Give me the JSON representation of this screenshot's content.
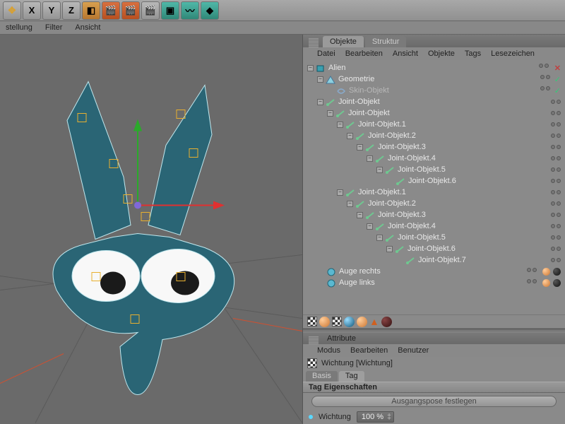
{
  "toolbar": {
    "axis_buttons": [
      "X",
      "Y",
      "Z"
    ],
    "submenu": [
      "stellung",
      "Filter",
      "Ansicht"
    ]
  },
  "panel": {
    "tabs": {
      "objects": "Objekte",
      "structure": "Struktur"
    },
    "menu": [
      "Datei",
      "Bearbeiten",
      "Ansicht",
      "Objekte",
      "Tags",
      "Lesezeichen"
    ]
  },
  "tree": [
    {
      "d": 0,
      "e": "-",
      "ic": "cube",
      "t": "Alien",
      "x": true
    },
    {
      "d": 1,
      "e": "-",
      "ic": "tri",
      "t": "Geometrie",
      "chk": true
    },
    {
      "d": 2,
      "e": "",
      "ic": "skin",
      "t": "Skin-Objekt",
      "dim": true,
      "chk": true
    },
    {
      "d": 1,
      "e": "-",
      "ic": "joint",
      "t": "Joint-Objekt"
    },
    {
      "d": 2,
      "e": "-",
      "ic": "joint",
      "t": "Joint-Objekt"
    },
    {
      "d": 3,
      "e": "-",
      "ic": "joint",
      "t": "Joint-Objekt.1"
    },
    {
      "d": 4,
      "e": "-",
      "ic": "joint",
      "t": "Joint-Objekt.2"
    },
    {
      "d": 5,
      "e": "-",
      "ic": "joint",
      "t": "Joint-Objekt.3"
    },
    {
      "d": 6,
      "e": "-",
      "ic": "joint",
      "t": "Joint-Objekt.4"
    },
    {
      "d": 7,
      "e": "-",
      "ic": "joint",
      "t": "Joint-Objekt.5"
    },
    {
      "d": 8,
      "e": "",
      "ic": "joint",
      "t": "Joint-Objekt.6"
    },
    {
      "d": 3,
      "e": "-",
      "ic": "joint",
      "t": "Joint-Objekt.1"
    },
    {
      "d": 4,
      "e": "-",
      "ic": "joint",
      "t": "Joint-Objekt.2"
    },
    {
      "d": 5,
      "e": "-",
      "ic": "joint",
      "t": "Joint-Objekt.3"
    },
    {
      "d": 6,
      "e": "-",
      "ic": "joint",
      "t": "Joint-Objekt.4"
    },
    {
      "d": 7,
      "e": "-",
      "ic": "joint",
      "t": "Joint-Objekt.5"
    },
    {
      "d": 8,
      "e": "-",
      "ic": "joint",
      "t": "Joint-Objekt.6"
    },
    {
      "d": 9,
      "e": "",
      "ic": "joint",
      "t": "Joint-Objekt.7"
    },
    {
      "d": 1,
      "e": "",
      "ic": "sphere",
      "t": "Auge rechts",
      "tags": true
    },
    {
      "d": 1,
      "e": "",
      "ic": "sphere",
      "t": "Auge links",
      "tags": true
    }
  ],
  "attributes": {
    "title": "Attribute",
    "menu": [
      "Modus",
      "Bearbeiten",
      "Benutzer"
    ],
    "weight_title": "Wichtung [Wichtung]",
    "subtabs": {
      "basis": "Basis",
      "tag": "Tag"
    },
    "props_header": "Tag Eigenschaften",
    "pose_btn": "Ausgangspose festlegen",
    "weight_label": "Wichtung",
    "weight_value": "100 %"
  }
}
